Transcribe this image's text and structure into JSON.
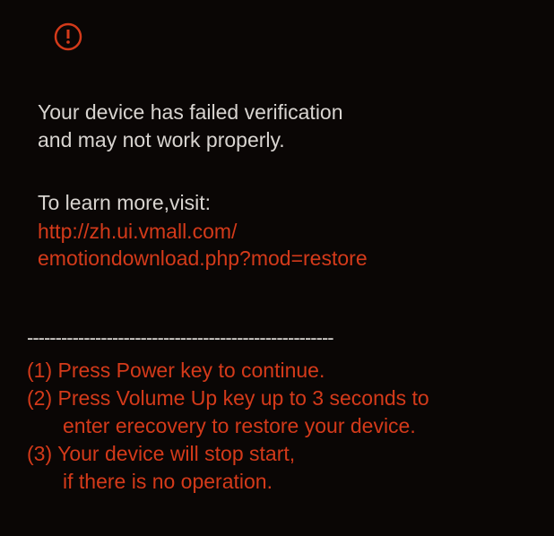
{
  "verification_line1": "Your device has failed verification",
  "verification_line2": "and may not work properly.",
  "learn_more": "To learn more,visit:",
  "url_line1": "http://zh.ui.vmall.com/",
  "url_line2": "emotiondownload.php?mod=restore",
  "divider": "------------------------------------------------------",
  "instructions": {
    "item1": "(1) Press Power key to continue.",
    "item2_line1": "(2) Press Volume Up key up to 3 seconds to",
    "item2_line2": "enter erecovery to restore your device.",
    "item3_line1": "(3) Your device will stop start,",
    "item3_line2": "if there is no operation."
  },
  "colors": {
    "background": "#0a0605",
    "text_white": "#d8d4d0",
    "text_red": "#d43a1a"
  }
}
